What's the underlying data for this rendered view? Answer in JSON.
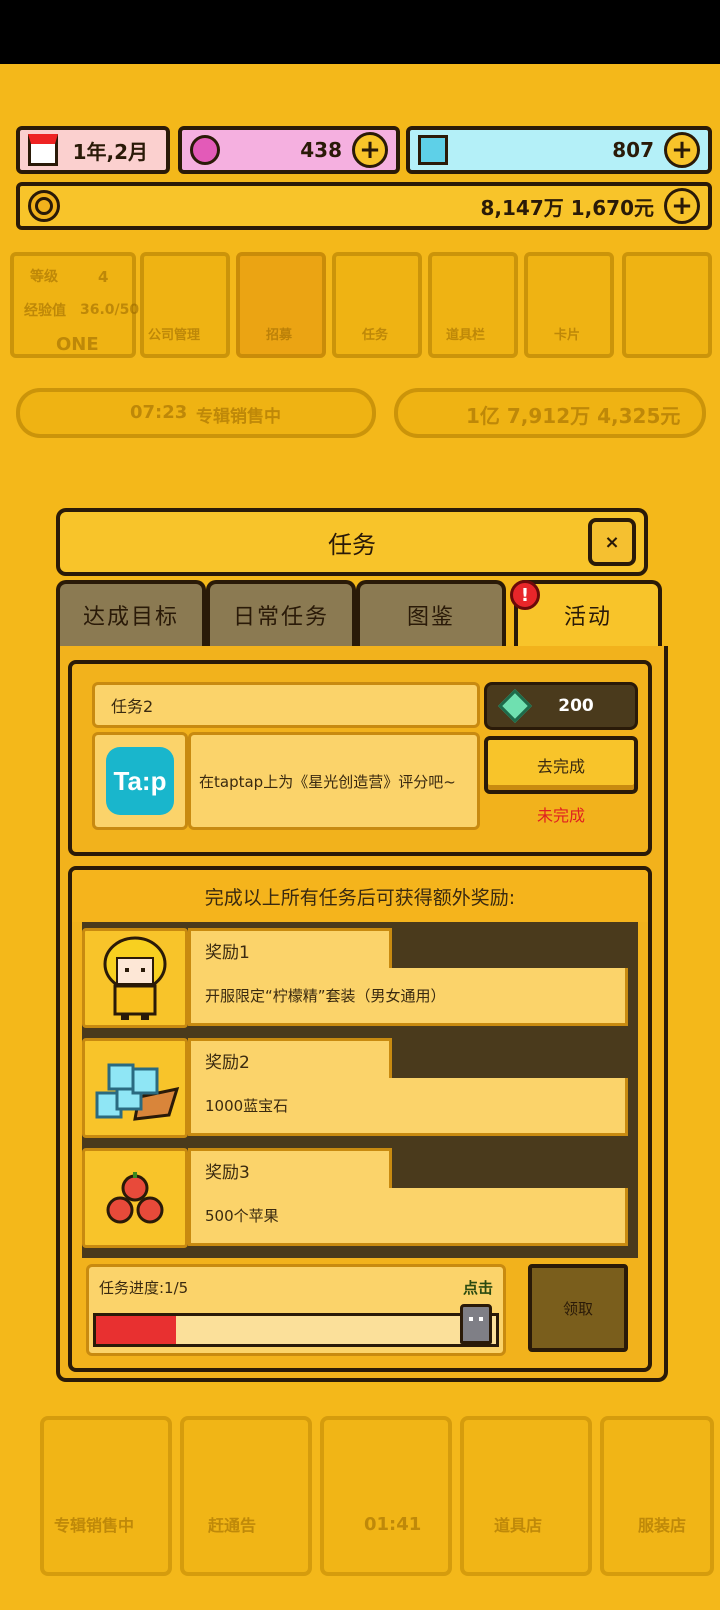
{
  "resources": {
    "date": "1年,2月",
    "pink_gems": "438",
    "blue_gems": "807",
    "money": "8,147万 1,670元"
  },
  "background": {
    "level_label": "等级",
    "level_value": "4",
    "exp_label": "经验值",
    "exp_value": "36.0/50",
    "company_name": "ONE",
    "menu": [
      "公司管理",
      "招募",
      "任务",
      "道具栏",
      "卡片"
    ],
    "sales_time": "07:23",
    "sales_status": "专辑销售中",
    "total_money": "1亿 7,912万 4,325元",
    "bottom_nav": [
      "专辑销售中",
      "赶通告",
      "01:41",
      "道具店",
      "服装店"
    ]
  },
  "dialog": {
    "title": "任务",
    "close": "×",
    "tabs": [
      "达成目标",
      "日常任务",
      "图鉴",
      "活动"
    ],
    "active_tab": 3,
    "alert": "!"
  },
  "task": {
    "name": "任务2",
    "logo_text": "Ta:p",
    "description": "在taptap上为《星光创造营》评分吧~",
    "reward_amount": "200",
    "go_button": "去完成",
    "status": "未完成"
  },
  "bonus": {
    "header": "完成以上所有任务后可获得额外奖励:",
    "rewards": [
      {
        "title": "奖励1",
        "desc": "开服限定“柠檬精”套装（男女通用）",
        "icon": "lemon-girl-icon"
      },
      {
        "title": "奖励2",
        "desc": "1000蓝宝石",
        "icon": "blue-gem-pile-icon"
      },
      {
        "title": "奖励3",
        "desc": "500个苹果",
        "icon": "apple-pile-icon"
      }
    ],
    "progress_label": "任务进度:1/5",
    "progress_fraction": 0.2,
    "click_label": "点击",
    "claim_button": "领取"
  },
  "colors": {
    "background": "#f4b81a",
    "panel": "#f2b21c",
    "cream": "#fbd36a",
    "outline": "#2a1a08",
    "progress": "#e83030",
    "incomplete": "#e02020"
  }
}
